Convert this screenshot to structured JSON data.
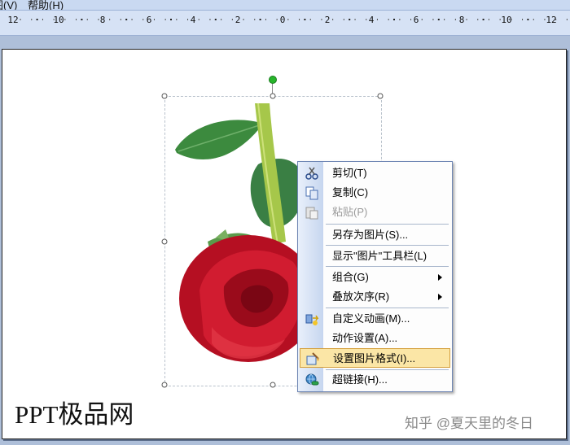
{
  "menubar": {
    "items": [
      "视图(V)",
      "帮助(H)"
    ]
  },
  "ruler": {
    "labels": [
      "12",
      "10",
      "8",
      "6",
      "4",
      "2",
      "0",
      "2",
      "4",
      "6",
      "8",
      "10",
      "12"
    ]
  },
  "context_menu": {
    "items": [
      {
        "label": "剪切(T)",
        "icon": "scissors-icon",
        "enabled": true,
        "submenu": false
      },
      {
        "label": "复制(C)",
        "icon": "copy-icon",
        "enabled": true,
        "submenu": false
      },
      {
        "label": "粘贴(P)",
        "icon": "paste-icon",
        "enabled": false,
        "submenu": false
      },
      {
        "label": "另存为图片(S)...",
        "icon": "",
        "enabled": true,
        "submenu": false
      },
      {
        "label": "显示\"图片\"工具栏(L)",
        "icon": "",
        "enabled": true,
        "submenu": false
      },
      {
        "label": "组合(G)",
        "icon": "",
        "enabled": true,
        "submenu": true
      },
      {
        "label": "叠放次序(R)",
        "icon": "",
        "enabled": true,
        "submenu": true
      },
      {
        "label": "自定义动画(M)...",
        "icon": "custom-animation-icon",
        "enabled": true,
        "submenu": false
      },
      {
        "label": "动作设置(A)...",
        "icon": "",
        "enabled": true,
        "submenu": false
      },
      {
        "label": "设置图片格式(I)...",
        "icon": "format-picture-icon",
        "enabled": true,
        "submenu": false,
        "highlighted": true
      },
      {
        "label": "超链接(H)...",
        "icon": "hyperlink-icon",
        "enabled": true,
        "submenu": false
      }
    ]
  },
  "watermarks": {
    "left": "PPT极品网",
    "right": "知乎 @夏天里的冬日"
  },
  "colors": {
    "menu_highlight": "#fbe6a6",
    "selection_handle": "#27b52b"
  }
}
